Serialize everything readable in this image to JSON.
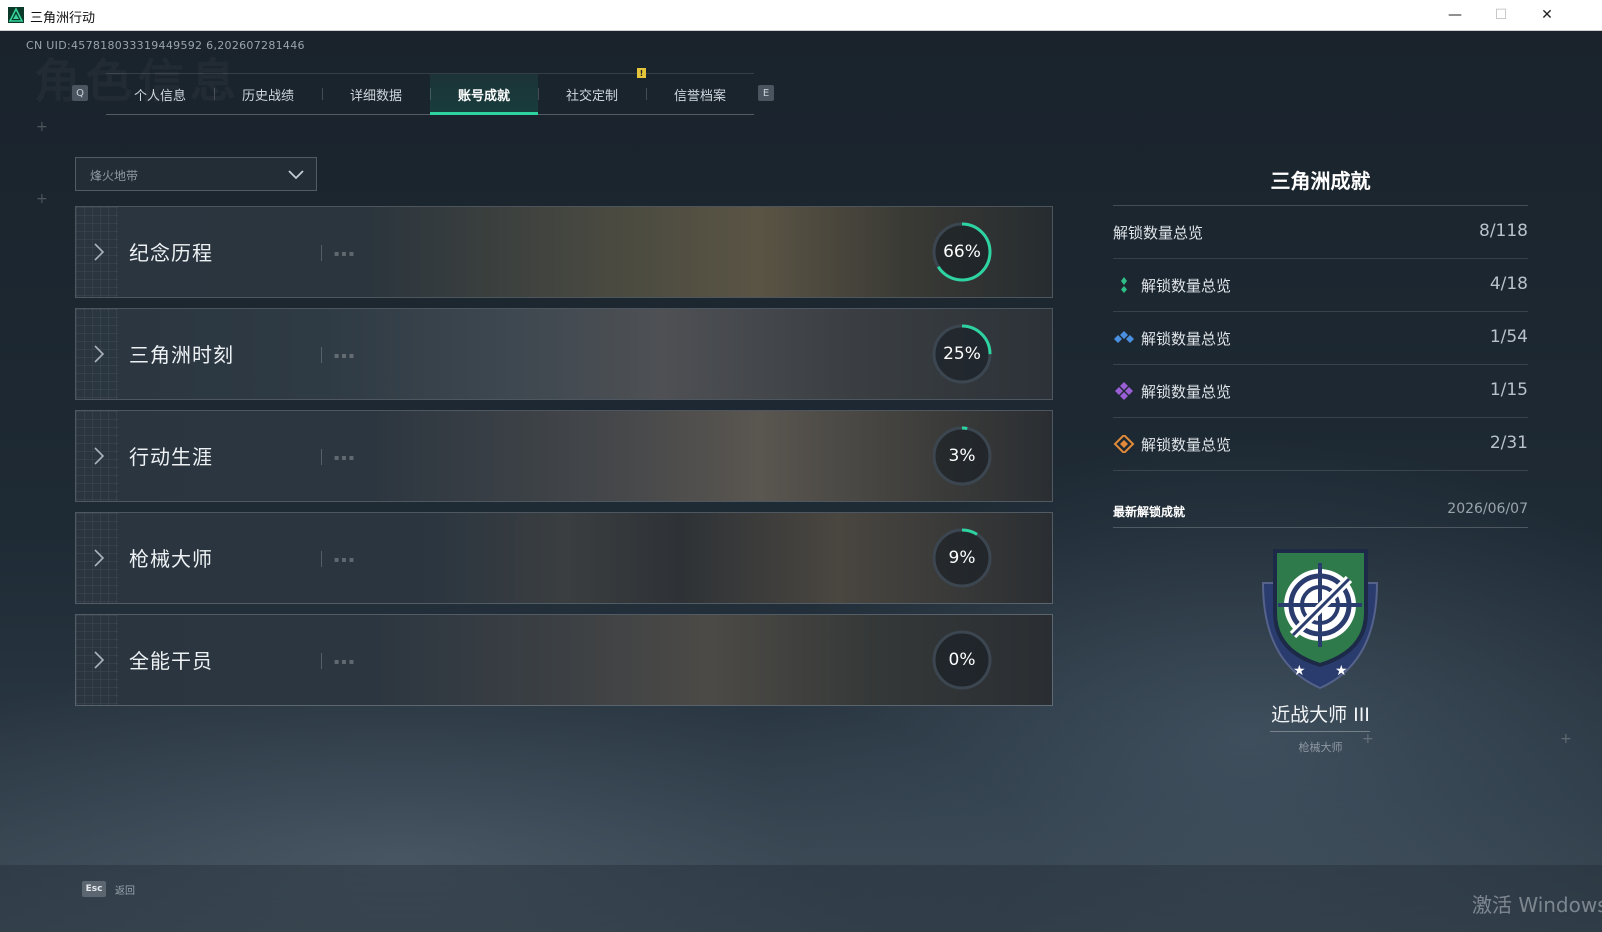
{
  "window": {
    "title": "三角洲行动",
    "minimize": "—",
    "maximize": "☐",
    "close": "✕"
  },
  "uid": "CN UID:457818033319449592 6,202607281446",
  "header_ghost": "角色信息",
  "tabs": {
    "prev_key": "Q",
    "next_key": "E",
    "items": [
      {
        "label": "个人信息"
      },
      {
        "label": "历史战绩"
      },
      {
        "label": "详细数据"
      },
      {
        "label": "账号成就",
        "active": true
      },
      {
        "label": "社交定制"
      },
      {
        "label": "信誉档案"
      }
    ],
    "alert": "!"
  },
  "mode_select": {
    "value": "烽火地带"
  },
  "categories": [
    {
      "label": "纪念历程",
      "percent": 66,
      "percent_text": "66%"
    },
    {
      "label": "三角洲时刻",
      "percent": 25,
      "percent_text": "25%"
    },
    {
      "label": "行动生涯",
      "percent": 3,
      "percent_text": "3%"
    },
    {
      "label": "枪械大师",
      "percent": 9,
      "percent_text": "9%"
    },
    {
      "label": "全能干员",
      "percent": 0,
      "percent_text": "0%"
    }
  ],
  "panel": {
    "title": "三角洲成就",
    "total": {
      "label": "解锁数量总览",
      "count": "8/118"
    },
    "tiers": [
      {
        "label": "解锁数量总览",
        "count": "4/18",
        "icon": "green-tier-icon",
        "color": "#2fbf86"
      },
      {
        "label": "解锁数量总览",
        "count": "1/54",
        "icon": "blue-tier-icon",
        "color": "#4a8fe0"
      },
      {
        "label": "解锁数量总览",
        "count": "1/15",
        "icon": "purple-tier-icon",
        "color": "#9a5fd6"
      },
      {
        "label": "解锁数量总览",
        "count": "2/31",
        "icon": "orange-tier-icon",
        "color": "#e08a3a"
      }
    ],
    "latest": {
      "heading": "最新解锁成就",
      "date": "2026/06/07",
      "name": "近战大师 III",
      "category": "枪械大师"
    }
  },
  "footer": {
    "esc_key": "Esc",
    "back_label": "返回",
    "watermark": "激活 Windows"
  },
  "colors": {
    "accent": "#2ed3a2",
    "ring_track": "#3c4650"
  }
}
